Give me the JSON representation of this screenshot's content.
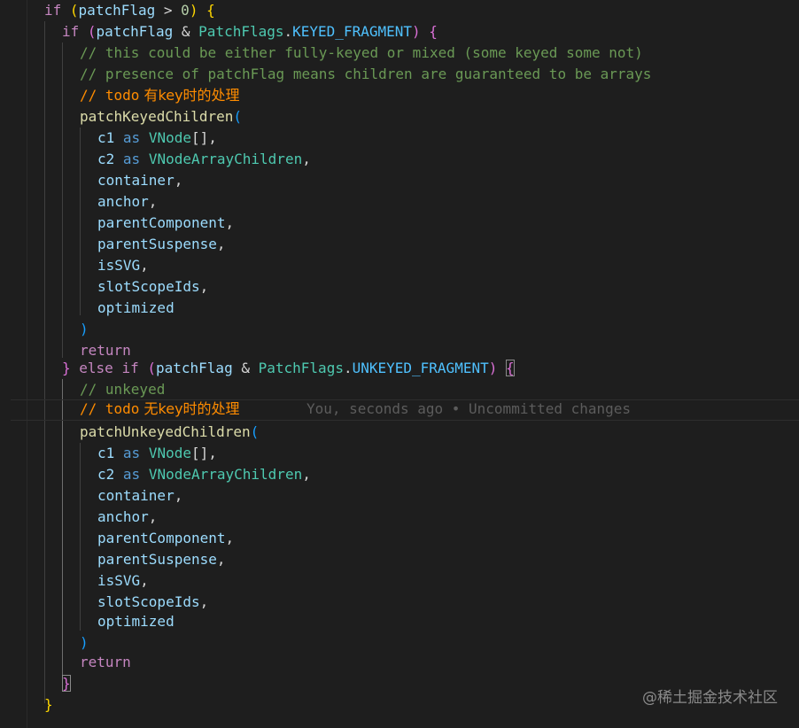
{
  "code": {
    "if_kw": "if",
    "else_kw": "else",
    "return_kw": "return",
    "as_kw": "as",
    "patchFlag": "patchFlag",
    "gt": ">",
    "amp": "&",
    "zero": "0",
    "PatchFlags": "PatchFlags",
    "KEYED_FRAGMENT": "KEYED_FRAGMENT",
    "UNKEYED_FRAGMENT": "UNKEYED_FRAGMENT",
    "comment_1": "// this could be either fully-keyed or mixed (some keyed some not)",
    "comment_2": "// presence of patchFlag means children are guaranteed to be arrays",
    "comment_todo_keyed_prefix": "// ",
    "comment_todo_word": "todo",
    "comment_todo_keyed_text": " 有key时的处理",
    "comment_unkeyed": "// unkeyed",
    "comment_todo_unkeyed_text": " 无key时的处理",
    "fn_keyed": "patchKeyedChildren",
    "fn_unkeyed": "patchUnkeyedChildren",
    "c1": "c1",
    "c2": "c2",
    "VNode": "VNode",
    "VNodeArrayChildren": "VNodeArrayChildren",
    "args": [
      "container",
      "anchor",
      "parentComponent",
      "parentSuspense",
      "isSVG",
      "slotScopeIds",
      "optimized"
    ]
  },
  "blame": {
    "text": "You, seconds ago • Uncommitted changes"
  },
  "watermark": {
    "text": "@稀土掘金技术社区"
  },
  "colors": {
    "background": "#1e1e1e",
    "keyword": "#c586c0",
    "variable": "#9cdcfe",
    "constant": "#4fc1ff",
    "type": "#4ec9b0",
    "function": "#dcdcaa",
    "comment": "#6a9955",
    "todo": "#ff8c00",
    "bracket_gold": "#ffd700",
    "bracket_orchid": "#da70d6",
    "bracket_blue": "#179fff"
  }
}
